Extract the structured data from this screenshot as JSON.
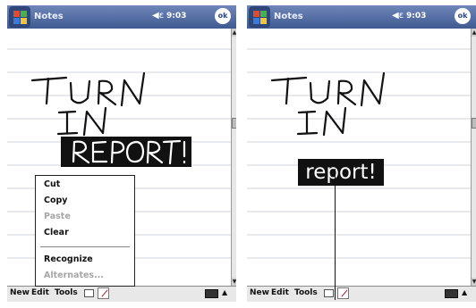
{
  "left_device": {
    "app_title": "Notes",
    "clock": "9:03",
    "ok_label": "ok",
    "ink_lines": [
      "TURN",
      "IN",
      "REPORT!"
    ],
    "context_menu": [
      {
        "label": "Cut",
        "enabled": true
      },
      {
        "label": "Copy",
        "enabled": true
      },
      {
        "label": "Paste",
        "enabled": false
      },
      {
        "label": "Clear",
        "enabled": true
      },
      {
        "label": "Recognize",
        "enabled": true
      },
      {
        "label": "Alternates...",
        "enabled": false
      }
    ],
    "menubar": {
      "new": "New",
      "edit": "Edit",
      "tools": "Tools"
    }
  },
  "right_device": {
    "app_title": "Notes",
    "clock": "9:03",
    "ok_label": "ok",
    "ink_lines": [
      "TURN",
      "IN"
    ],
    "recognized_word": "report!",
    "menubar": {
      "new": "New",
      "edit": "Edit",
      "tools": "Tools"
    }
  },
  "colors": {
    "title_bar": "#3f5a92",
    "highlight": "#111111",
    "ink": "#111111",
    "menubar": "#e8e8e8"
  }
}
